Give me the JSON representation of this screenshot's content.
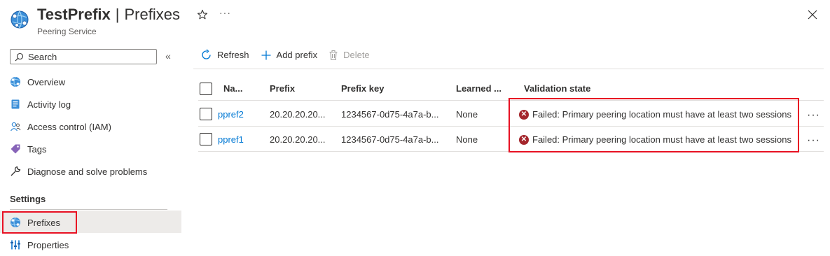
{
  "header": {
    "resource_name": "TestPrefix",
    "separator": "|",
    "page_name": "Prefixes",
    "subtitle": "Peering Service",
    "more_label": "···"
  },
  "sidebar": {
    "search_placeholder": "Search",
    "collapse_label": "«",
    "items": [
      {
        "label": "Overview",
        "icon": "globe-icon"
      },
      {
        "label": "Activity log",
        "icon": "activity-log-icon"
      },
      {
        "label": "Access control (IAM)",
        "icon": "people-icon"
      },
      {
        "label": "Tags",
        "icon": "tag-icon"
      },
      {
        "label": "Diagnose and solve problems",
        "icon": "wrench-icon"
      }
    ],
    "section_label": "Settings",
    "settings_items": [
      {
        "label": "Prefixes",
        "icon": "globe-icon",
        "selected": true
      },
      {
        "label": "Properties",
        "icon": "properties-icon"
      }
    ]
  },
  "toolbar": {
    "refresh_label": "Refresh",
    "add_prefix_label": "Add prefix",
    "delete_label": "Delete"
  },
  "table": {
    "columns": [
      "Na...",
      "Prefix",
      "Prefix key",
      "Learned ...",
      "Validation state"
    ],
    "rows": [
      {
        "name": "ppref2",
        "prefix": "20.20.20.20...",
        "prefix_key": "1234567-0d75-4a7a-b...",
        "learned": "None",
        "validation": "Failed: Primary peering location must have at least two sessions"
      },
      {
        "name": "ppref1",
        "prefix": "20.20.20.20...",
        "prefix_key": "1234567-0d75-4a7a-b...",
        "learned": "None",
        "validation": "Failed: Primary peering location must have at least two sessions"
      }
    ],
    "row_more_label": "···"
  },
  "colors": {
    "link": "#0078d4",
    "error": "#a4262c",
    "highlight_box": "#e81123",
    "selected_bg": "#edebe9"
  }
}
